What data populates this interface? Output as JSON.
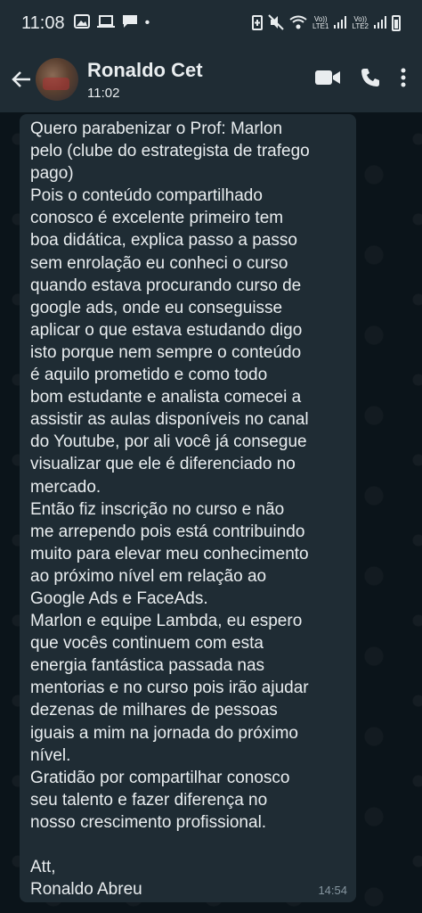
{
  "status_bar": {
    "time": "11:08",
    "dot": "•",
    "net1": "Vo))\nLTE1",
    "net2": "Vo))\nLTE2"
  },
  "header": {
    "contact_name": "Ronaldo Cet",
    "last_seen": "11:02"
  },
  "message": {
    "text": "Quero parabenizar o Prof: Marlon\npelo (clube do estrategista de trafego\npago)\nPois o conteúdo compartilhado\nconosco é excelente primeiro tem\nboa didática, explica passo a passo\nsem enrolação eu conheci o curso\nquando estava procurando curso de\ngoogle ads, onde eu conseguisse\naplicar o que estava estudando digo\nisto porque nem sempre o conteúdo\né aquilo prometido e como todo\nbom estudante e analista comecei a\nassistir as aulas disponíveis no canal\ndo Youtube, por ali você já consegue\nvisualizar que ele é diferenciado no\nmercado.\nEntão fiz inscrição no curso e não\nme arrependo pois está contribuindo\nmuito para elevar meu conhecimento\nao próximo nível em relação ao\nGoogle Ads e FaceAds.\nMarlon e equipe Lambda, eu espero\nque vocês continuem com esta\nenergia fantástica passada nas\nmentorias e no curso pois irão ajudar\ndezenas de milhares de pessoas\niguais a mim na jornada do próximo\nnível.\nGratidão por compartilhar conosco\nseu talento e fazer diferença no\nnosso crescimento profissional.\n\nAtt,\nRonaldo Abreu",
    "time": "14:54"
  }
}
